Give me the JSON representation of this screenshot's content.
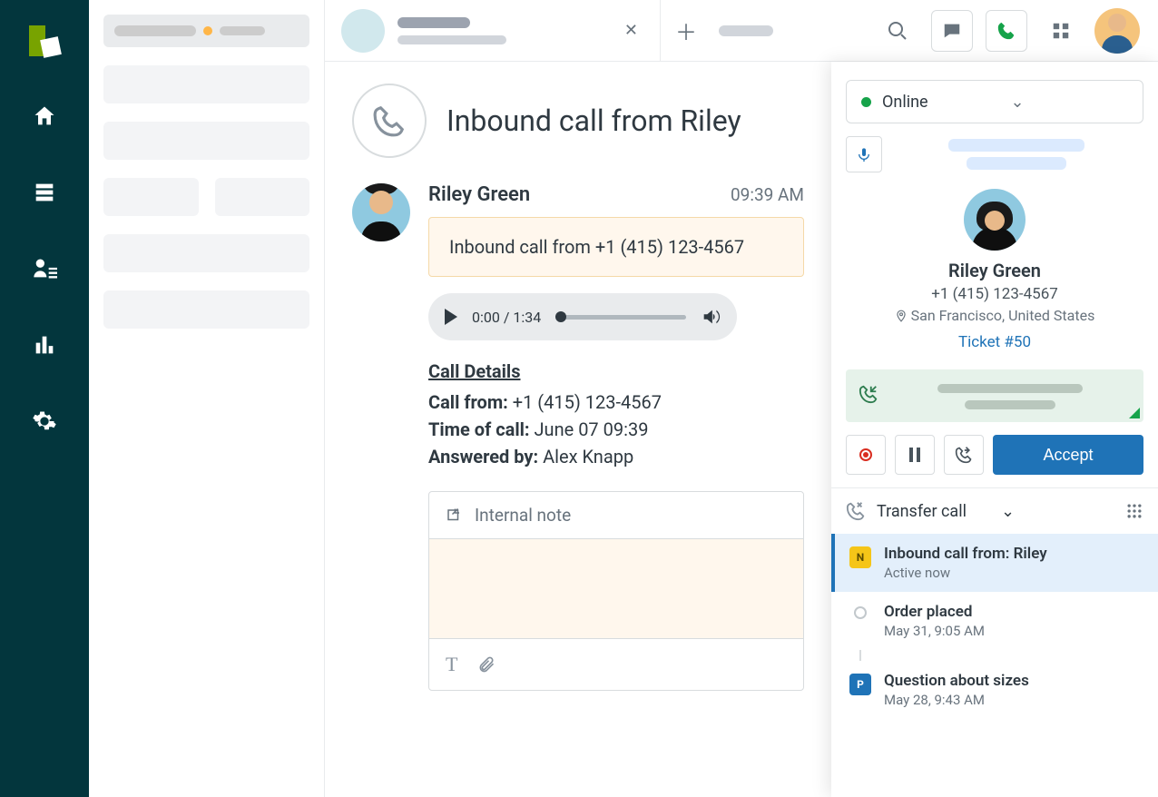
{
  "ticket": {
    "title": "Inbound call from Riley",
    "caller_name": "Riley Green",
    "time": "09:39 AM",
    "inbound_line": "Inbound call from +1 (415) 123-4567",
    "audio": {
      "elapsed": "0:00",
      "total": "1:34"
    },
    "details_heading": "Call Details",
    "call_from_label": "Call from:",
    "call_from_value": "+1 (415) 123-4567",
    "time_label": "Time of call:",
    "time_value": "June 07 09:39",
    "answered_label": "Answered by:",
    "answered_value": "Alex Knapp"
  },
  "composer": {
    "tab": "Internal note"
  },
  "call_panel": {
    "status": "Online",
    "caller": {
      "name": "Riley Green",
      "phone": "+1 (415) 123-4567",
      "location": "San Francisco, United States",
      "ticket": "Ticket #50"
    },
    "accept": "Accept",
    "transfer": "Transfer call"
  },
  "timeline": [
    {
      "title": "Inbound call from: Riley",
      "sub": "Active now",
      "badge": "N",
      "active": true
    },
    {
      "title": "Order placed",
      "sub": "May 31, 9:05 AM",
      "badge": "",
      "active": false
    },
    {
      "title": "Question about sizes",
      "sub": "May 28, 9:43 AM",
      "badge": "P",
      "active": false
    }
  ]
}
